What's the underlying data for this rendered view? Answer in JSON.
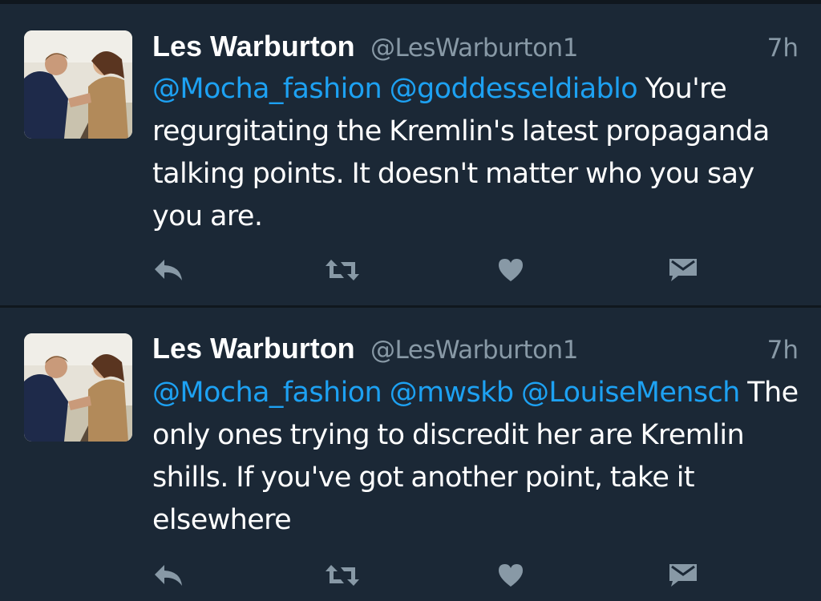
{
  "colors": {
    "background": "#1b2836",
    "divider": "#10171e",
    "name": "#ffffff",
    "secondary": "#8899a6",
    "mention": "#1da1f2",
    "icon": "#8899a6"
  },
  "tweets": [
    {
      "name": "Les Warburton",
      "handle": "@LesWarburton1",
      "time": "7h",
      "mentions": [
        "@Mocha_fashion",
        "@goddesseldiablo"
      ],
      "text": "You're regurgitating the Kremlin's latest propaganda talking points. It doesn't matter who you say you are.",
      "actions": [
        "reply-icon",
        "retweet-icon",
        "heart-icon",
        "direct-message-icon"
      ]
    },
    {
      "name": "Les Warburton",
      "handle": "@LesWarburton1",
      "time": "7h",
      "mentions": [
        "@Mocha_fashion",
        "@mwskb",
        "@LouiseMensch"
      ],
      "text": "The only ones trying to discredit her are Kremlin shills. If you've got another point, take it elsewhere",
      "actions": [
        "reply-icon",
        "retweet-icon",
        "heart-icon",
        "direct-message-icon"
      ]
    }
  ]
}
